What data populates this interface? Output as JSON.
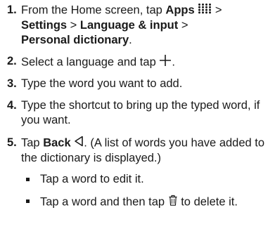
{
  "steps": [
    {
      "num": "1.",
      "pre": "From the Home screen, tap ",
      "apps": "Apps",
      "gt1": " > ",
      "settings": "Settings",
      "gt2": " > ",
      "language_input": "Language & input",
      "gt3": " > ",
      "personal_dictionary": "Personal dictionary",
      "end": ".",
      "icon": "apps-grid-icon"
    },
    {
      "num": "2.",
      "text": "Select a language and tap ",
      "icon": "plus-icon",
      "end": "."
    },
    {
      "num": "3.",
      "text": "Type the word you want to add."
    },
    {
      "num": "4.",
      "text": "Type the shortcut to bring up the typed word, if you want."
    },
    {
      "num": "5.",
      "pre": "Tap ",
      "back": "Back",
      "post": ". (A list of words you have added to the dictionary is displayed.)",
      "icon": "back-triangle-icon"
    }
  ],
  "subitems": [
    {
      "text": "Tap a word to edit it."
    },
    {
      "pre": "Tap a word and then tap ",
      "post": " to delete it.",
      "icon": "trash-icon"
    }
  ]
}
